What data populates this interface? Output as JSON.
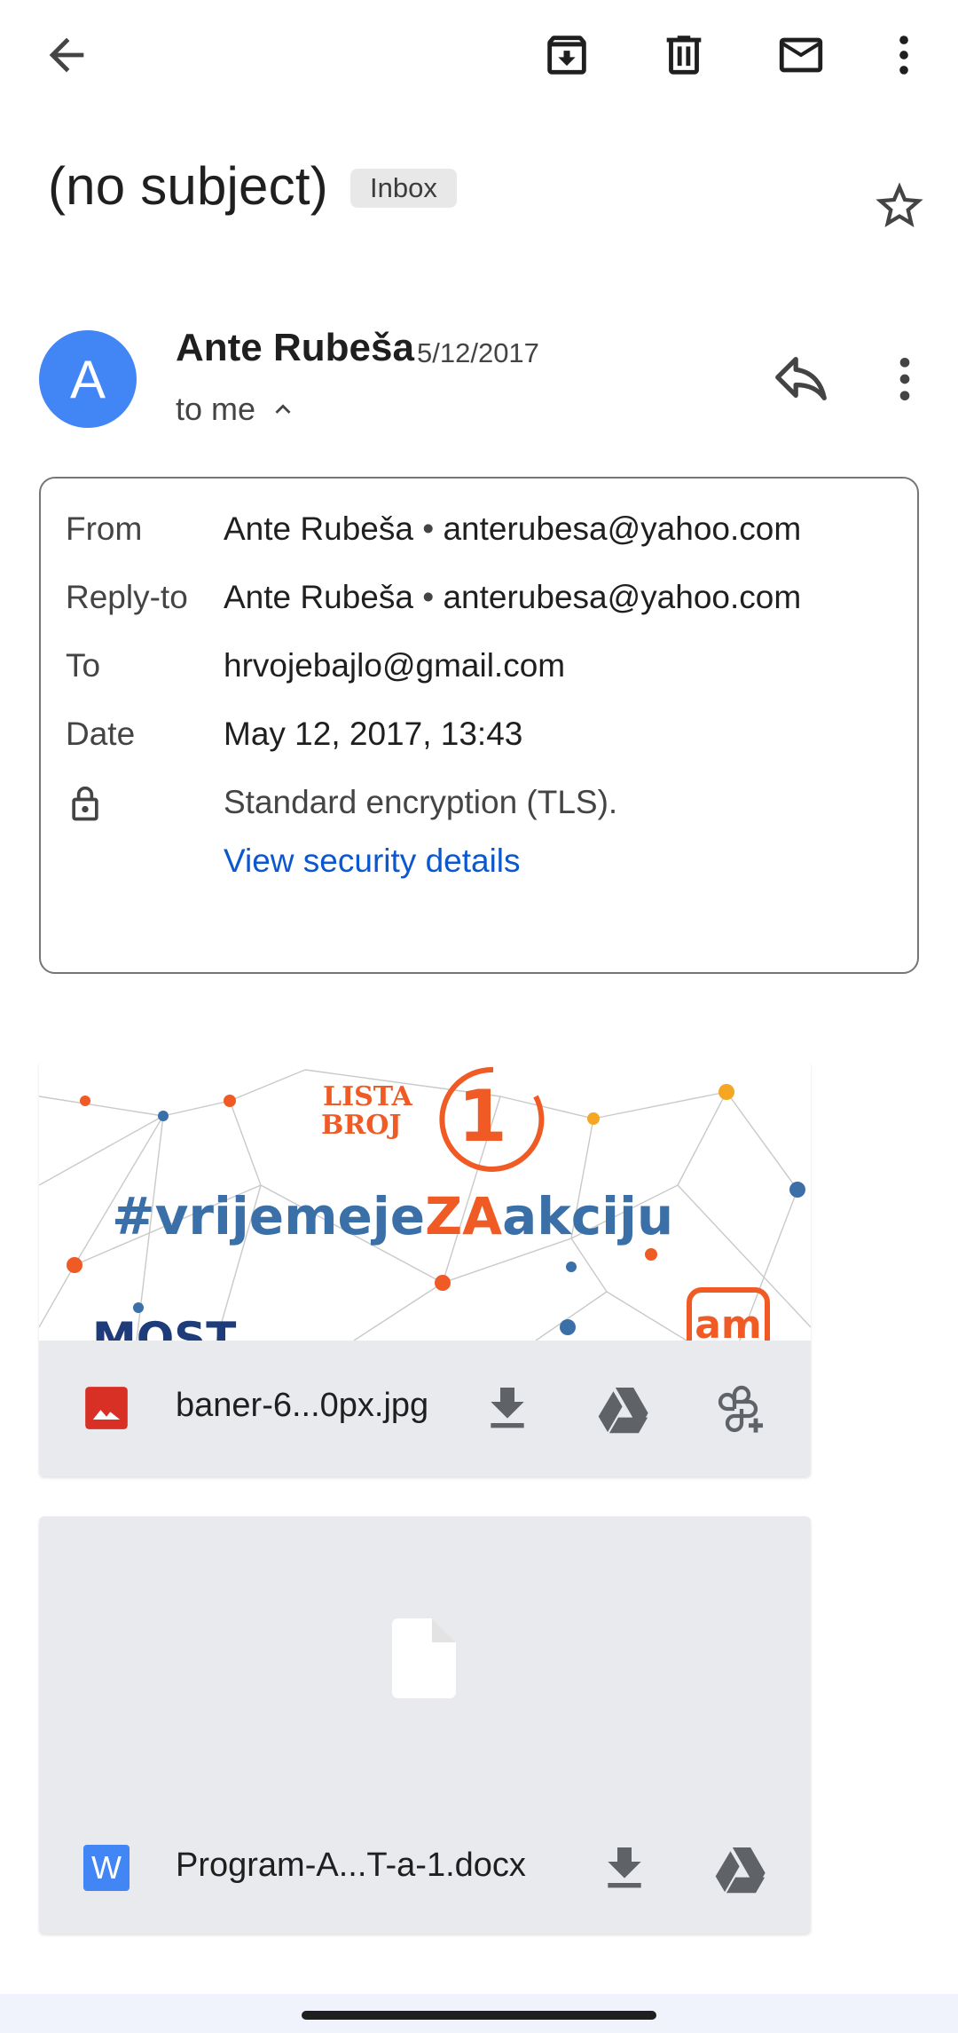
{
  "toolbar": {
    "back_icon": "arrow-back-icon",
    "archive_icon": "archive-icon",
    "delete_icon": "trash-icon",
    "mark_unread_icon": "mail-icon",
    "more_icon": "more-vert-icon"
  },
  "email": {
    "subject": "(no subject)",
    "label": "Inbox",
    "starred": false
  },
  "sender": {
    "avatar_letter": "A",
    "avatar_color": "#4285f4",
    "name": "Ante Rubeša",
    "date": "5/12/2017",
    "recipient_summary": "to me"
  },
  "details": {
    "from_label": "From",
    "from_name": "Ante Rubeša",
    "from_email": "anterubesa@yahoo.com",
    "reply_to_label": "Reply-to",
    "reply_to_name": "Ante Rubeša",
    "reply_to_email": "anterubesa@yahoo.com",
    "to_label": "To",
    "to_value": "hrvojebajlo@gmail.com",
    "date_label": "Date",
    "date_value": "May 12, 2017, 13:43",
    "encryption": "Standard encryption (TLS).",
    "security_link": "View security details",
    "separator": "•"
  },
  "attachments": [
    {
      "file_name": "baner-6...0px.jpg",
      "type_icon": "image-file-icon",
      "preview": {
        "top_line": "LISTA",
        "bottom_line": "BROJ",
        "number": "1",
        "hashtag_start": "#vrijemeje",
        "hashtag_mid": "ZA",
        "hashtag_end": "akciju",
        "logo_text": "MOST",
        "badge_text": "am"
      }
    },
    {
      "file_name": "Program-A...T-a-1.docx",
      "type_icon": "word-file-icon",
      "type_letter": "W"
    }
  ],
  "colors": {
    "accent_link": "#0b57d0",
    "banner_blue": "#3b6fa8",
    "banner_orange": "#f05a24"
  }
}
